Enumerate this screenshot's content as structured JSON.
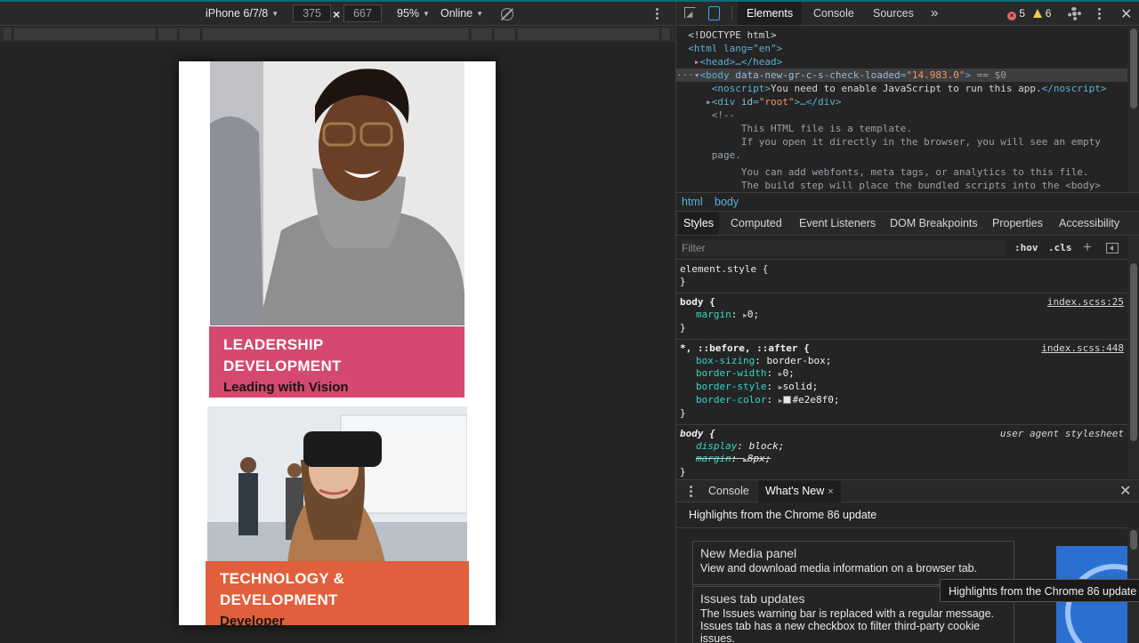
{
  "device_toolbar": {
    "device": "iPhone 6/7/8",
    "width": "375",
    "height": "667",
    "dim_separator": "×",
    "zoom": "95%",
    "network": "Online"
  },
  "page": {
    "card1": {
      "title_line1": "LEADERSHIP",
      "title_line2": "DEVELOPMENT",
      "subtitle": "Leading with Vision",
      "color": "#d5496f"
    },
    "card2": {
      "title_line1": "TECHNOLOGY &",
      "title_line2": "DEVELOPMENT",
      "subtitle": "Developer",
      "color": "#e15f3c"
    }
  },
  "devtools": {
    "tabs": [
      "Elements",
      "Console",
      "Sources"
    ],
    "more": "»",
    "errors": "5",
    "warnings": "6",
    "dom": {
      "doctype": "<!DOCTYPE html>",
      "html_open": "<html lang=\"en\">",
      "head": "<head>…</head>",
      "body_attr": "data-new-gr-c-s-check-loaded",
      "body_attr_value": "\"14.983.0\"",
      "body_suffix": " == $0",
      "noscript_text": "You need to enable JavaScript to run this app.",
      "root_div_id": "\"root\"",
      "comment_open": "<!--",
      "comment_1": "This HTML file is a template.",
      "comment_2": "If you open it directly in the browser, you will see an empty",
      "comment_3": "page.",
      "comment_4": "You can add webfonts, meta tags, or analytics to this file.",
      "comment_5": "The build step will place the bundled scripts into the <body>"
    },
    "breadcrumbs": [
      "html",
      "body"
    ],
    "subtabs": [
      "Styles",
      "Computed",
      "Event Listeners",
      "DOM Breakpoints",
      "Properties",
      "Accessibility"
    ],
    "filter_placeholder": "Filter",
    "hov": ":hov",
    "cls": ".cls",
    "styles": {
      "element_style": "element.style {",
      "rule1_selector": "body {",
      "rule1_source": "index.scss:25",
      "rule1_prop": "margin",
      "rule1_value": "0;",
      "rule2_selector": "*, ::before, ::after {",
      "rule2_source": "index.scss:448",
      "rule2_props": [
        {
          "name": "box-sizing",
          "value": "border-box;"
        },
        {
          "name": "border-width",
          "value": "0;"
        },
        {
          "name": "border-style",
          "value": "solid;"
        },
        {
          "name": "border-color",
          "value": "#e2e8f0;"
        }
      ],
      "rule3_selector": "body {",
      "rule3_source": "user agent stylesheet",
      "rule3_prop1": "display",
      "rule3_value1": "block;",
      "rule3_prop2": "margin",
      "rule3_value2": "8px;",
      "close_brace": "}"
    },
    "drawer": {
      "tabs": [
        "Console",
        "What's New"
      ],
      "close_x": "×",
      "header": "Highlights from the Chrome 86 update",
      "items": [
        {
          "title": "New Media panel",
          "desc": "View and download media information on a browser tab."
        },
        {
          "title": "Issues tab updates",
          "desc": "The Issues warning bar is replaced with a regular message. Issues tab has a new checkbox to filter third-party cookie issues."
        }
      ],
      "tooltip": "Highlights from the Chrome 86 update"
    }
  }
}
